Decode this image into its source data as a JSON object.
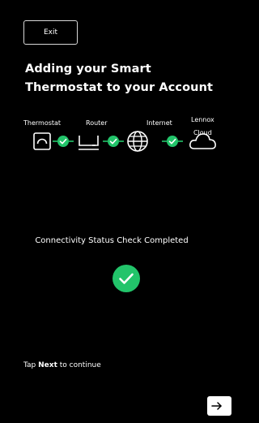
{
  "header": {
    "exit_label": "Exit"
  },
  "title": "Adding your Smart Thermostat to your Account",
  "network_chain": {
    "labels": {
      "thermostat": "Thermostat",
      "router": "Router",
      "internet": "Internet",
      "cloud_line1": "Lennox",
      "cloud_line2": "Cloud"
    },
    "icons": [
      "thermostat-icon",
      "router-icon",
      "globe-icon",
      "cloud-icon"
    ],
    "links_connected": [
      true,
      true,
      true
    ]
  },
  "status": {
    "message": "Connectivity Status Check Completed",
    "state": "completed",
    "icon": "check-circle-icon"
  },
  "hint": {
    "prefix": "Tap",
    "bold": "Next",
    "suffix": "to continue"
  },
  "nav": {
    "next_icon": "arrow-right-icon"
  },
  "colors": {
    "accent": "#22c46a",
    "background": "#000000",
    "text": "#ffffff"
  }
}
